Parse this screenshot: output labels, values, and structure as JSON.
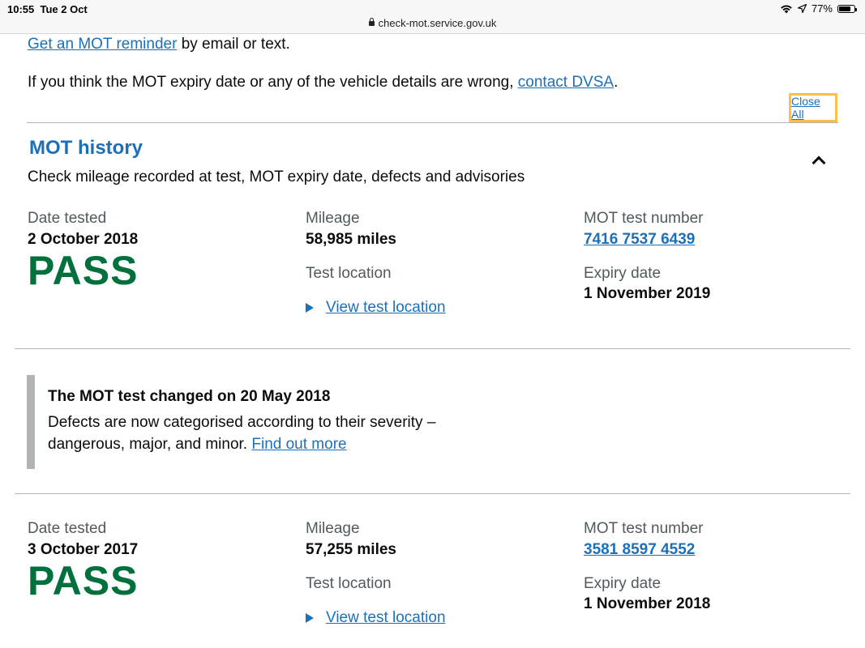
{
  "status_bar": {
    "time": "10:55",
    "date": "Tue 2 Oct",
    "url": "check-mot.service.gov.uk",
    "battery": "77%"
  },
  "intro": {
    "reminder_link": "Get an MOT reminder",
    "reminder_text": " by email or text.",
    "wrong_text": "If you think the MOT expiry date or any of the vehicle details are wrong, ",
    "contact_link": "contact DVSA",
    "wrong_end": "."
  },
  "close_all": "Close All",
  "history": {
    "title": "MOT history",
    "subtitle": "Check mileage recorded at test, MOT expiry date, defects and advisories"
  },
  "labels": {
    "date_tested": "Date tested",
    "mileage": "Mileage",
    "test_location": "Test location",
    "mot_test_number": "MOT test number",
    "expiry_date": "Expiry date",
    "view_test_location": "View test location"
  },
  "tests": [
    {
      "date": "2 October 2018",
      "result": "PASS",
      "mileage": "58,985 miles",
      "test_number": "7416 7537 6439",
      "expiry": "1 November 2019"
    },
    {
      "date": "3 October 2017",
      "result": "PASS",
      "mileage": "57,255 miles",
      "test_number": "3581 8597 4552",
      "expiry": "1 November 2018"
    }
  ],
  "notice": {
    "title": "The MOT test changed on 20 May 2018",
    "line1": "Defects are now categorised according to their severity –",
    "line2": "dangerous, major, and minor. ",
    "link": "Find out more"
  },
  "colors": {
    "link": "#1d70b8",
    "pass": "#00703c",
    "focus": "#ffbf47"
  }
}
